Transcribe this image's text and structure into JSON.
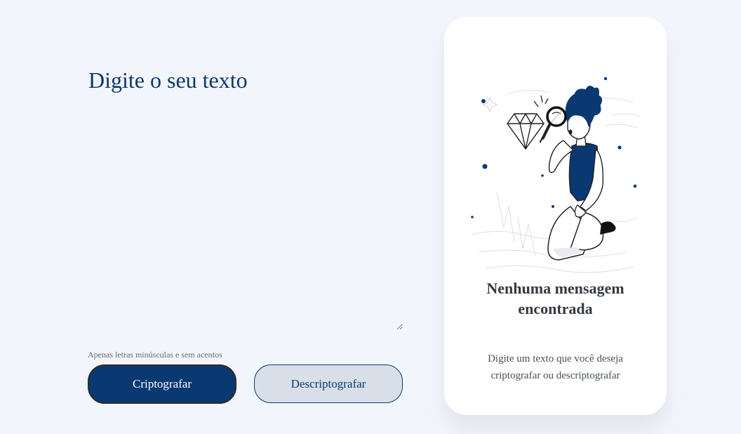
{
  "input": {
    "placeholder": "Digite o seu texto",
    "value": ""
  },
  "hint": {
    "icon": "info-icon",
    "text": "Apenas letras minúsculas e sem acentos"
  },
  "buttons": {
    "encrypt_label": "Criptografar",
    "decrypt_label": "Descriptografar"
  },
  "output": {
    "illustration": "person-searching-with-magnifier",
    "title": "Nenhuma mensagem encontrada",
    "message": "Digite um texto que você deseja criptografar ou descriptografar"
  },
  "colors": {
    "accent": "#0a3871",
    "background": "#f3f5fc",
    "card": "#ffffff",
    "secondary_button": "#d8dfe8"
  }
}
